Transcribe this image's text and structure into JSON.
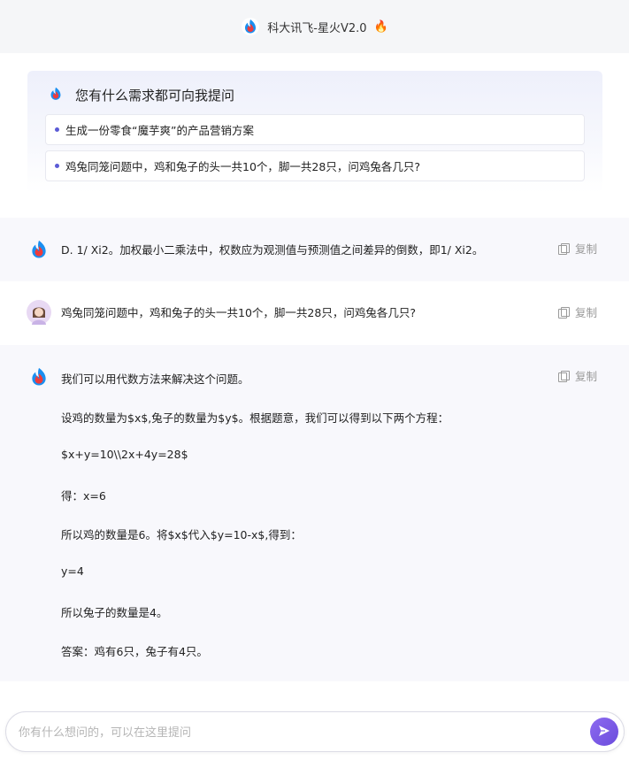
{
  "header": {
    "title": "科大讯飞-星火V2.0",
    "emoji": "🔥"
  },
  "welcome": {
    "title": "您有什么需求都可向我提问",
    "suggestions": [
      "生成一份零食“魔芋爽”的产品营销方案",
      "鸡兔同笼问题中，鸡和兔子的头一共10个，脚一共28只，问鸡兔各几只?"
    ]
  },
  "messages": [
    {
      "role": "assistant",
      "text": "D. 1/ Xi2。加权最小二乘法中，权数应为观测值与预测值之间差异的倒数，即1/ Xi2。",
      "copy_label": "复制"
    },
    {
      "role": "user",
      "text": "鸡兔同笼问题中，鸡和兔子的头一共10个，脚一共28只，问鸡兔各几只?",
      "copy_label": "复制"
    },
    {
      "role": "assistant",
      "copy_label": "复制",
      "paragraphs": [
        "我们可以用代数方法来解决这个问题。",
        "设鸡的数量为$x$,兔子的数量为$y$。根据题意，我们可以得到以下两个方程：",
        "$x+y=10\\\\2x+4y=28$",
        "得：x=6",
        "所以鸡的数量是6。将$x$代入$y=10-x$,得到：",
        "y=4",
        "所以兔子的数量是4。",
        "答案：鸡有6只，兔子有4只。"
      ]
    }
  ],
  "input": {
    "placeholder": "你有什么想问的，可以在这里提问"
  },
  "colors": {
    "accent": "#6b4bdc",
    "bullet": "#5b5bd6"
  },
  "icons": {
    "logo": "spark-logo-icon",
    "copy": "copy-icon",
    "send": "send-icon",
    "user": "user-avatar"
  }
}
